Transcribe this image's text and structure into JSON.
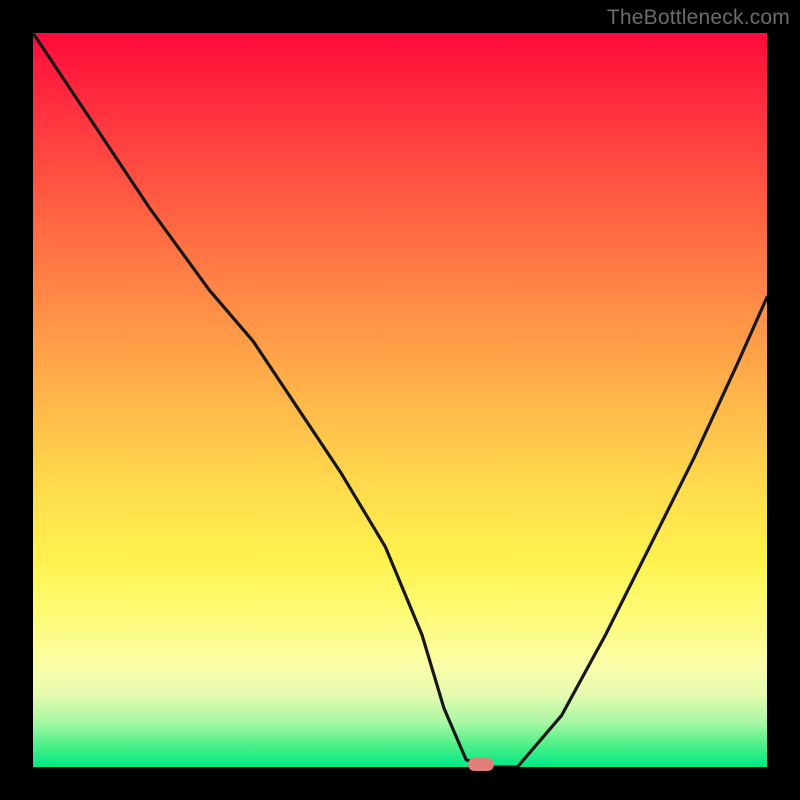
{
  "watermark": "TheBottleneck.com",
  "colors": {
    "frame_border": "#000000",
    "curve_stroke": "#171717",
    "marker_fill": "#e37f7b",
    "gradient_top": "#ff0a3a",
    "gradient_bottom": "#00e884"
  },
  "chart_data": {
    "type": "line",
    "title": "",
    "xlabel": "",
    "ylabel": "",
    "xlim": [
      0,
      100
    ],
    "ylim": [
      0,
      100
    ],
    "x": [
      0,
      8,
      16,
      24,
      30,
      36,
      42,
      48,
      53,
      56,
      59,
      62,
      66,
      72,
      78,
      84,
      90,
      96,
      100
    ],
    "values": [
      100,
      88,
      76,
      65,
      58,
      49,
      40,
      30,
      18,
      8,
      1,
      0,
      0,
      7,
      18,
      30,
      42,
      55,
      64
    ],
    "marker": {
      "x": 61,
      "y": 0
    },
    "note": "x and y are percentages of the plot area; y=100 is top, y=0 is bottom; values read off pixel positions"
  }
}
